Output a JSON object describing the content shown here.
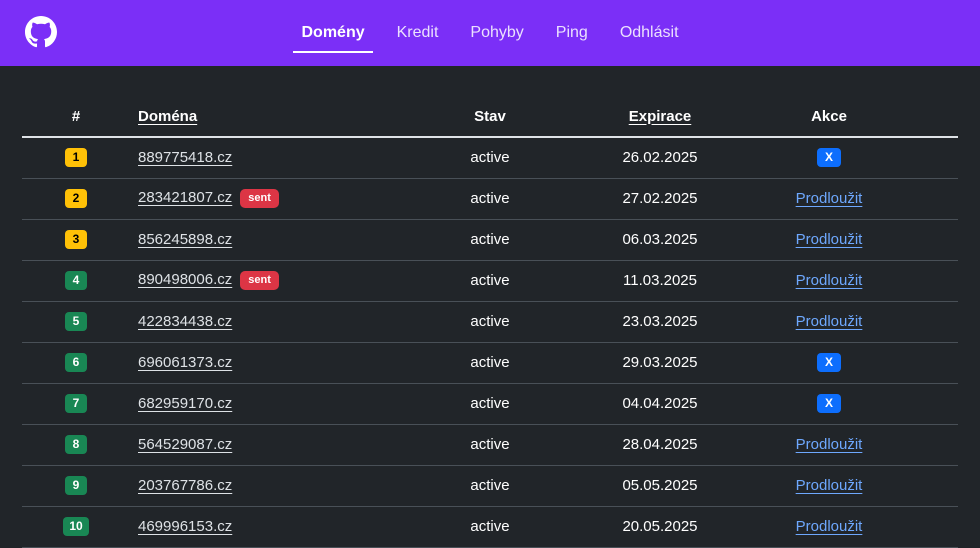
{
  "nav": {
    "logo_icon": "github-icon",
    "items": [
      {
        "label": "Domény",
        "active": true
      },
      {
        "label": "Kredit",
        "active": false
      },
      {
        "label": "Pohyby",
        "active": false
      },
      {
        "label": "Ping",
        "active": false
      },
      {
        "label": "Odhlásit",
        "active": false
      }
    ]
  },
  "table": {
    "headers": {
      "num": "#",
      "domain": "Doména",
      "status": "Stav",
      "expiration": "Expirace",
      "action": "Akce"
    },
    "rows": [
      {
        "num": "1",
        "badge_color": "yellow",
        "domain": "889775418.cz",
        "sent": "",
        "status": "active",
        "expiration": "26.02.2025",
        "action": "X"
      },
      {
        "num": "2",
        "badge_color": "yellow",
        "domain": "283421807.cz",
        "sent": "sent",
        "status": "active",
        "expiration": "27.02.2025",
        "action": "Prodloužit"
      },
      {
        "num": "3",
        "badge_color": "yellow",
        "domain": "856245898.cz",
        "sent": "",
        "status": "active",
        "expiration": "06.03.2025",
        "action": "Prodloužit"
      },
      {
        "num": "4",
        "badge_color": "green",
        "domain": "890498006.cz",
        "sent": "sent",
        "status": "active",
        "expiration": "11.03.2025",
        "action": "Prodloužit"
      },
      {
        "num": "5",
        "badge_color": "green",
        "domain": "422834438.cz",
        "sent": "",
        "status": "active",
        "expiration": "23.03.2025",
        "action": "Prodloužit"
      },
      {
        "num": "6",
        "badge_color": "green",
        "domain": "696061373.cz",
        "sent": "",
        "status": "active",
        "expiration": "29.03.2025",
        "action": "X"
      },
      {
        "num": "7",
        "badge_color": "green",
        "domain": "682959170.cz",
        "sent": "",
        "status": "active",
        "expiration": "04.04.2025",
        "action": "X"
      },
      {
        "num": "8",
        "badge_color": "green",
        "domain": "564529087.cz",
        "sent": "",
        "status": "active",
        "expiration": "28.04.2025",
        "action": "Prodloužit"
      },
      {
        "num": "9",
        "badge_color": "green",
        "domain": "203767786.cz",
        "sent": "",
        "status": "active",
        "expiration": "05.05.2025",
        "action": "Prodloužit"
      },
      {
        "num": "10",
        "badge_color": "green",
        "domain": "469996153.cz",
        "sent": "",
        "status": "active",
        "expiration": "20.05.2025",
        "action": "Prodloužit"
      }
    ]
  },
  "colors": {
    "navbar": "#7b2ff7",
    "background": "#212529",
    "yellow": "#ffc107",
    "green": "#198754",
    "red": "#dc3545",
    "blue": "#0d6efd",
    "link": "#6ea8fe"
  }
}
